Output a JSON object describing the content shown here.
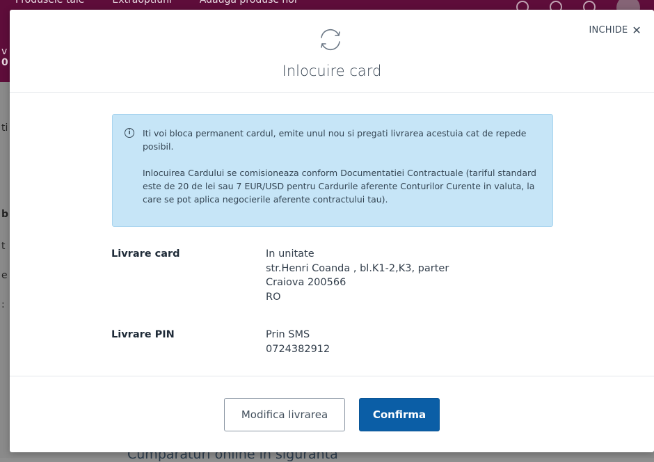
{
  "background": {
    "nav": [
      "Produsele tale",
      "Extraoptiuni",
      "Adauga produse noi"
    ],
    "frag_v": "v",
    "frag_0": "0",
    "frag_ti": "ti",
    "frag_b": "b",
    "frag_t": "t",
    "frag_e": "e",
    "frag_colon": ":",
    "bottom_text": "Cumparaturi online in siguranta"
  },
  "modal": {
    "close_label": "INCHIDE",
    "close_icon": "close-icon",
    "header_icon": "refresh-icon",
    "title": "Inlocuire card",
    "info": {
      "icon": "info-icon",
      "p1": "Iti voi bloca permanent cardul, emite unul nou si pregati livrarea acestuia cat de repede posibil.",
      "p2": "Inlocuirea Cardului se comisioneaza conform Documentatiei Contractuale (tariful standard este de 20 de lei sau 7 EUR/USD pentru Cardurile aferente Conturilor Curente in valuta, la care se pot aplica negocierile aferente contractului tau)."
    },
    "card_delivery": {
      "label": "Livrare card",
      "lines": [
        "In unitate",
        "str.Henri Coanda , bl.K1-2,K3, parter",
        "Craiova 200566",
        "RO"
      ]
    },
    "pin_delivery": {
      "label": "Livrare PIN",
      "lines": [
        "Prin SMS",
        "0724382912"
      ]
    },
    "buttons": {
      "modify": "Modifica livrarea",
      "confirm": "Confirma"
    }
  },
  "colors": {
    "primary": "#0b5ea6",
    "info_bg": "#c6e5f7",
    "topbar": "#5e0d3a"
  }
}
